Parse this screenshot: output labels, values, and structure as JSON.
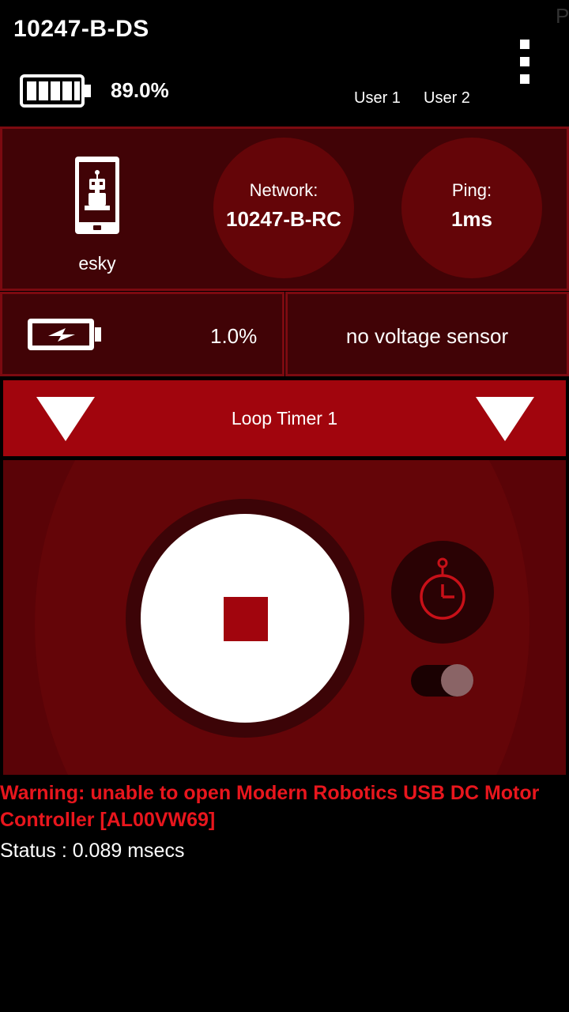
{
  "header": {
    "title": "10247-B-DS",
    "corner_letter": "P",
    "battery_percent": "89.0%",
    "battery_level": 0.89,
    "users": [
      "User 1",
      "User 2"
    ],
    "menu_icon": "overflow-menu-icon"
  },
  "robot_status": {
    "device_icon": "phone-robot-icon",
    "device_name": "esky",
    "network_label": "Network:",
    "network_value": "10247-B-RC",
    "ping_label": "Ping:",
    "ping_value": "1ms"
  },
  "power": {
    "battery_icon": "battery-charging-icon",
    "battery_percent": "1.0%",
    "voltage_text": "no voltage sensor"
  },
  "opmode": {
    "label": "Loop Timer 1",
    "left_icon": "dropdown-triangle-icon",
    "right_icon": "dropdown-triangle-icon"
  },
  "controls": {
    "stop_icon": "stop-icon",
    "timer_icon": "stopwatch-icon",
    "timer_enabled": false
  },
  "messages": {
    "warning": "Warning: unable to open Modern Robotics USB DC Motor Controller [AL00VW69]",
    "status": "Status : 0.089 msecs"
  },
  "colors": {
    "panel_bg": "#410306",
    "panel_border": "#7c0a10",
    "circle": "#640508",
    "accent": "#a1050d",
    "warning": "#e8161d"
  }
}
